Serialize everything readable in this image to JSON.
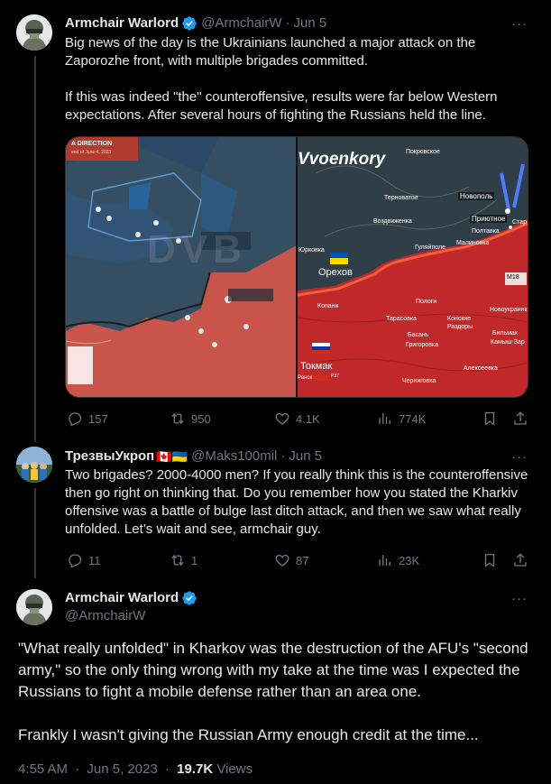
{
  "tweet1": {
    "name": "Armchair Warlord",
    "handle": "@ArmchairW",
    "date": "Jun 5",
    "paragraphs": [
      "Big news of the day is the Ukrainians launched a major attack on the Zaporozhe front, with multiple brigades committed.",
      "If this was indeed \"the\" counteroffensive, results were far below Western expectations.  After several hours of fighting the Russians held the line."
    ],
    "media": {
      "left_map": {
        "title": "A DIRECTION",
        "subtitle": "end of June 4, 2023",
        "watermark": "DVB"
      },
      "right_map": {
        "logo": "Vvoenkory",
        "places": [
          "Покровское",
          "Терноватое",
          "Новополь",
          "Приютное",
          "Воздвиженка",
          "Полтавка",
          "Малиновка",
          "Гуляйполе",
          "Юрковка",
          "Орехов",
          "Копани",
          "Пологи",
          "Конские Раздоры",
          "Новоукраинк",
          "Тарасовка",
          "Басань",
          "Бильмак",
          "Камыш-Зар",
          "Григоровка",
          "Токмак",
          "Алексеевка",
          "Черниговка",
          "Стар",
          "Ранск"
        ],
        "road_labels": [
          "M18",
          "P37"
        ]
      }
    },
    "stats": {
      "replies": "157",
      "reposts": "950",
      "likes": "4.1K",
      "views": "774K"
    }
  },
  "tweet2": {
    "name": "ТрезвыУкроп",
    "flags": "🇨🇦🇺🇦",
    "handle": "@Maks100mil",
    "date": "Jun 5",
    "text": "Two brigades? 2000-4000 men? If you really think this is the counteroffensive then go right on thinking that. Do you remember how you stated the Kharkiv offensive was a battle of bulge last ditch attack, and then we saw what really unfolded. Let’s wait and see, armchair guy.",
    "stats": {
      "replies": "11",
      "reposts": "1",
      "likes": "87",
      "views": "23K"
    }
  },
  "tweet3": {
    "name": "Armchair Warlord",
    "handle": "@ArmchairW",
    "paragraphs": [
      "\"What really unfolded\" in Kharkov was the destruction of the AFU's \"second army,\" so the only thing wrong with my take at the time was I expected the Russians to fight a mobile defense rather than an area one.",
      "Frankly I wasn't giving the Russian Army enough credit at the time..."
    ],
    "time": "4:55 AM",
    "date": "Jun 5, 2023",
    "views_count": "19.7K",
    "views_label": "Views"
  },
  "separator": "·",
  "more_glyph": "···",
  "colors": {
    "background": "#000000",
    "text": "#e7e9ea",
    "muted": "#71767b",
    "verified": "#1d9bf0",
    "border": "#2f3336"
  }
}
